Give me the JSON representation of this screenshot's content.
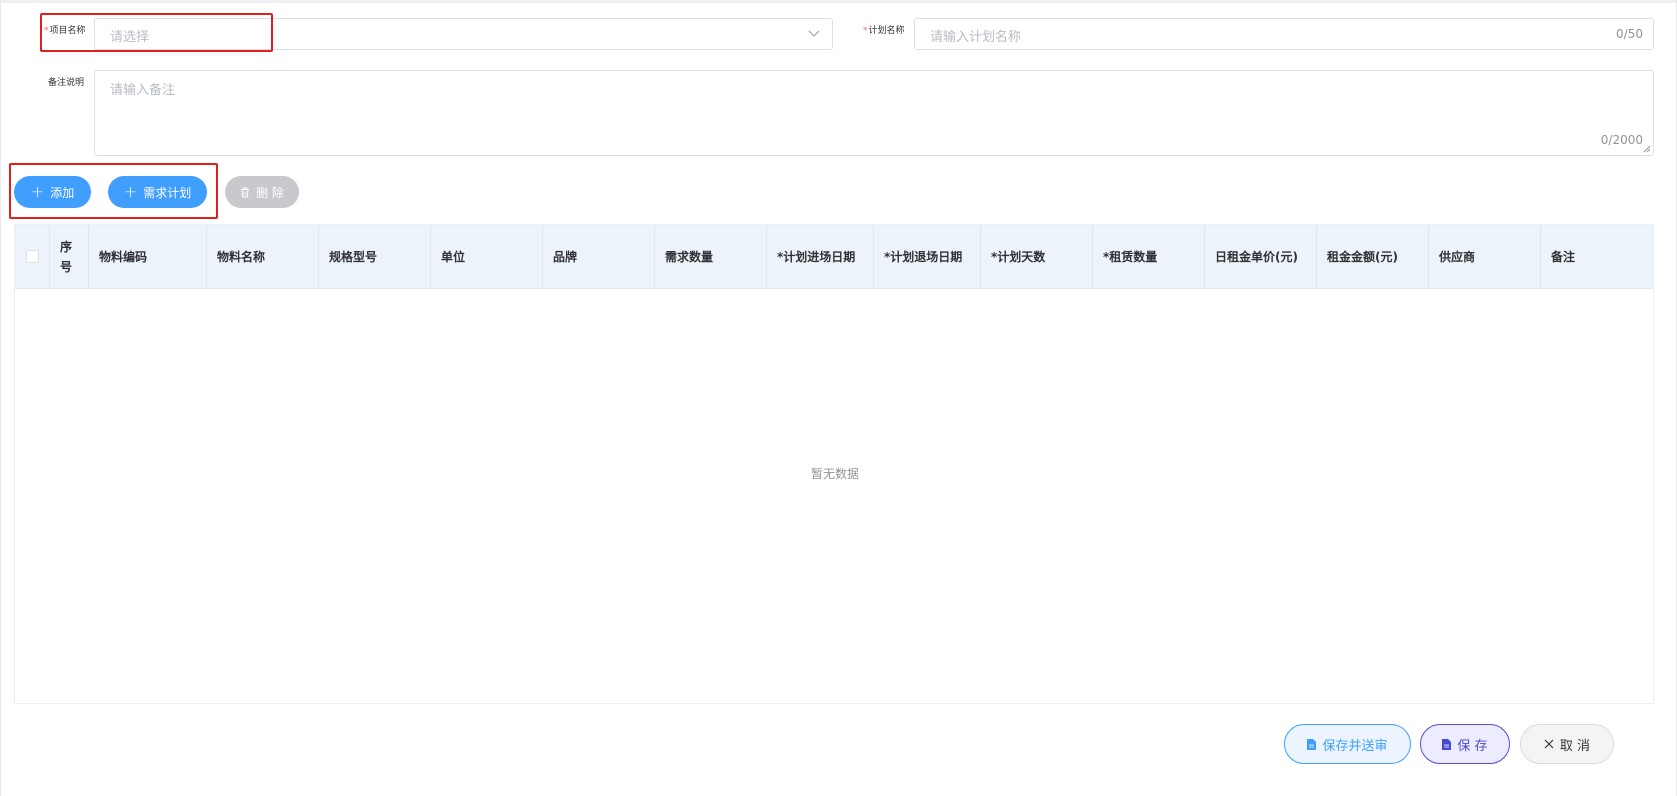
{
  "form": {
    "project_label": "项目名称",
    "project_placeholder": "请选择",
    "plan_label": "计划名称",
    "plan_placeholder": "请输入计划名称",
    "plan_counter": "0/50",
    "remark_label": "备注说明",
    "remark_placeholder": "请输入备注",
    "remark_counter": "0/2000"
  },
  "toolbar": {
    "add_label": "添加",
    "demand_plan_label": "需求计划",
    "delete_label": "删 除"
  },
  "table": {
    "columns": [
      "序号",
      "物料编码",
      "物料名称",
      "规格型号",
      "单位",
      "品牌",
      "需求数量",
      "*计划进场日期",
      "*计划退场日期",
      "*计划天数",
      "*租赁数量",
      "日租金单价(元)",
      "租金金额(元)",
      "供应商",
      "备注"
    ],
    "seq_line1": "序",
    "seq_line2": "号",
    "empty_text": "暂无数据"
  },
  "footer": {
    "submit_label": "保存并送审",
    "save_label": "保 存",
    "cancel_label": "取 消"
  },
  "colors": {
    "primary": "#409eff",
    "highlight_box": "#e0201b",
    "save_border": "#4f4fd6"
  }
}
